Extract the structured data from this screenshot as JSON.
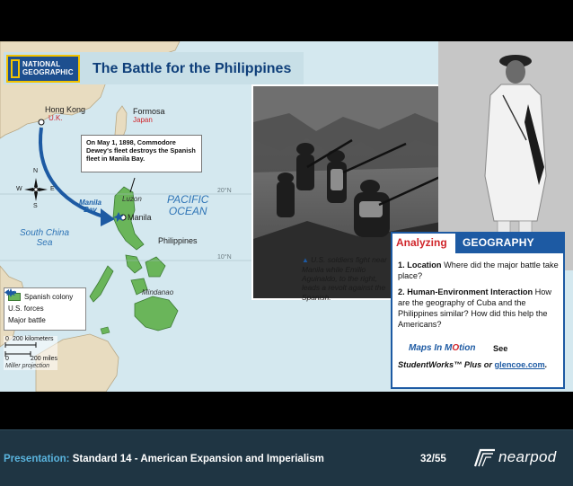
{
  "slide": {
    "map": {
      "publisher_logo_lines": [
        "NATIONAL",
        "GEOGRAPHIC"
      ],
      "title": "The Battle for the Philippines",
      "callout": "On May 1, 1898, Commodore Dewey's fleet destroys the Spanish fleet in Manila Bay.",
      "labels": {
        "hong_kong": "Hong Kong",
        "uk": "U.K.",
        "formosa": "Formosa",
        "japan": "Japan",
        "luzon": "Luzon",
        "manila": "Manila",
        "manila_bay": "Manila\nBay",
        "pacific_ocean": "PACIFIC\nOCEAN",
        "south_china_sea": "South China\nSea",
        "philippines": "Philippines",
        "mindanao": "Mindanao",
        "lat_20": "20°N",
        "lat_10": "10°N",
        "compass_n": "N",
        "compass_s": "S",
        "compass_e": "E",
        "compass_w": "W"
      },
      "legend": [
        {
          "label": "Spanish colony",
          "symbol": "green-swatch"
        },
        {
          "label": "U.S. forces",
          "symbol": "blue-arrow"
        },
        {
          "label": "Major battle",
          "symbol": "battle-star"
        }
      ],
      "scale": {
        "km_zero": "0",
        "km_label": "200 kilometers",
        "mi_zero": "0",
        "mi_label": "200 miles",
        "projection": "Miller projection"
      }
    },
    "caption": "U.S. soldiers fight near Manila while Emilio Aguinaldo, to the right, leads a revolt against the Spanish.",
    "analyzing": {
      "heading_red": "Analyzing",
      "heading_white": "GEOGRAPHY",
      "q1_num": "1.",
      "q1_title": "Location",
      "q1_text": "Where did the major battle take place?",
      "q2_num": "2.",
      "q2_title": "Human-Environment Interaction",
      "q2_text": "How are the geography of Cuba and the Philippines similar? How did this help the Americans?",
      "maps_in_motion_a": "Maps In M",
      "maps_in_motion_b": "O",
      "maps_in_motion_c": "tion",
      "see": "See",
      "studentworks": "StudentWorks™ Plus or ",
      "link": "glencoe.com",
      "period": "."
    }
  },
  "footer": {
    "presentation_label": "Presentation:",
    "presentation_title": "Standard 14 - American Expansion and Imperialism",
    "page": "32/55",
    "brand": "nearpod"
  },
  "colors": {
    "water": "#d4e8ef",
    "land": "#e8dcc0",
    "spanish_colony": "#6ab55a",
    "us_forces": "#1d5aa3",
    "footer_bg": "#1f3543",
    "footer_accent": "#5ab4de"
  }
}
